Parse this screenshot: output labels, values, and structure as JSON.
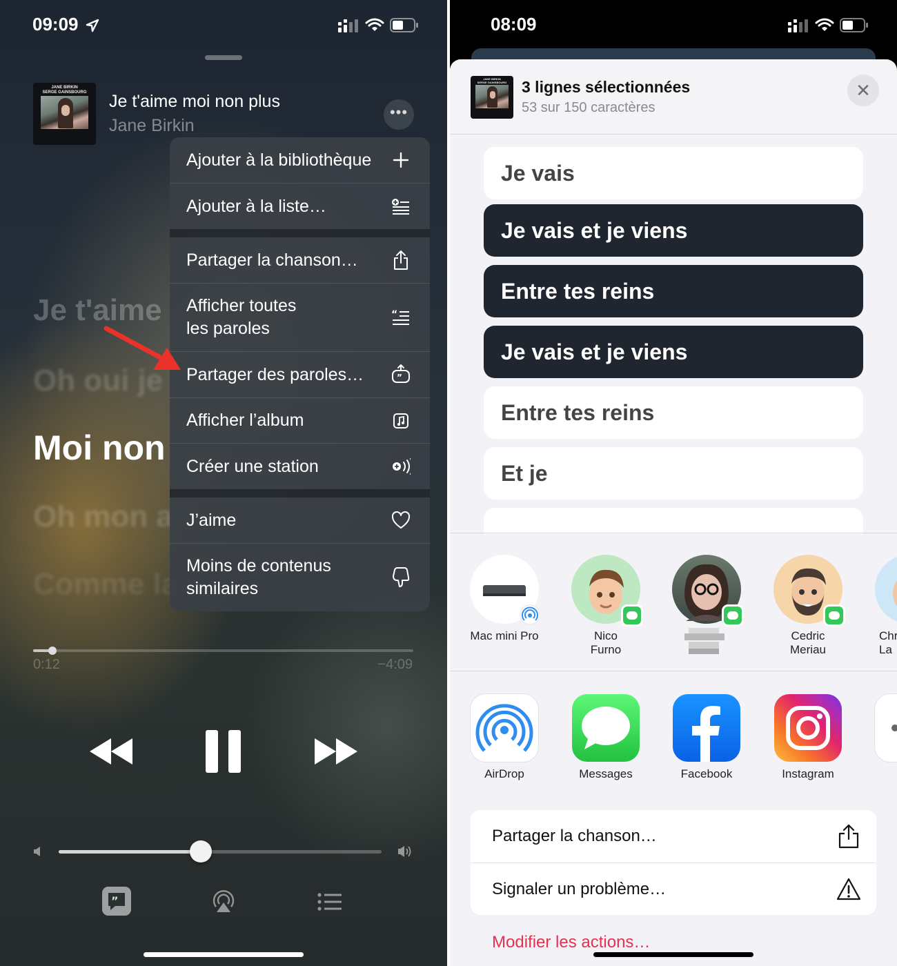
{
  "left": {
    "status": {
      "time": "09:09"
    },
    "now_playing": {
      "title": "Je t'aime moi non plus",
      "artist": "Jane Birkin",
      "album_cover_text": "JANE BIRKIN\nSERGE GAINSBOURG",
      "more_label": "•••"
    },
    "lyrics": {
      "line1": "Je t'aime",
      "line2": "Oh oui je",
      "current": "Moi non",
      "line4": "Oh mon a",
      "line5": "Comme la"
    },
    "menu": {
      "items": [
        {
          "label": "Ajouter à la bibliothèque",
          "icon": "plus-icon"
        },
        {
          "label": "Ajouter à la liste…",
          "icon": "add-to-list-icon"
        },
        {
          "label": "Partager la chanson…",
          "icon": "share-icon"
        },
        {
          "label": "Afficher toutes\nles paroles",
          "icon": "lyrics-list-icon"
        },
        {
          "label": "Partager des paroles…",
          "icon": "share-lyrics-icon"
        },
        {
          "label": "Afficher l’album",
          "icon": "album-icon"
        },
        {
          "label": "Créer une station",
          "icon": "station-icon"
        },
        {
          "label": "J’aime",
          "icon": "heart-icon"
        },
        {
          "label": "Moins de contenus\nsimilaires",
          "icon": "thumbs-down-icon"
        }
      ]
    },
    "playback": {
      "elapsed": "0:12",
      "remaining": "−4:09",
      "progress": 0.05,
      "volume": 0.44
    },
    "arrow_color": "#e8322a"
  },
  "right": {
    "status": {
      "time": "08:09"
    },
    "sheet": {
      "title": "3 lignes sélectionnées",
      "subtitle": "53 sur 150 caractères",
      "close_label": "✕"
    },
    "lyric_lines": [
      {
        "text": "Je vais",
        "selected": false
      },
      {
        "text": "Je vais et je viens",
        "selected": true
      },
      {
        "text": "Entre tes reins",
        "selected": true
      },
      {
        "text": "Je vais et je viens",
        "selected": true
      },
      {
        "text": "Entre tes reins",
        "selected": false
      },
      {
        "text": "Et je",
        "selected": false
      }
    ],
    "contacts": [
      {
        "name": "Mac mini Pro",
        "kind": "device"
      },
      {
        "name": "Nico\nFurno",
        "kind": "memoji"
      },
      {
        "name": "",
        "kind": "photo"
      },
      {
        "name": "Cedric\nMeriau",
        "kind": "memoji"
      },
      {
        "name": "Chr\nLa",
        "kind": "memoji"
      }
    ],
    "apps": [
      {
        "name": "AirDrop",
        "icon": "airdrop-icon"
      },
      {
        "name": "Messages",
        "icon": "messages-icon"
      },
      {
        "name": "Facebook",
        "icon": "facebook-icon"
      },
      {
        "name": "Instagram",
        "icon": "instagram-icon"
      }
    ],
    "actions": [
      {
        "label": "Partager la chanson…",
        "icon": "share-icon"
      },
      {
        "label": "Signaler un problème…",
        "icon": "warning-icon"
      }
    ],
    "modify_label": "Modifier les actions…",
    "accent": "#e8304f"
  }
}
